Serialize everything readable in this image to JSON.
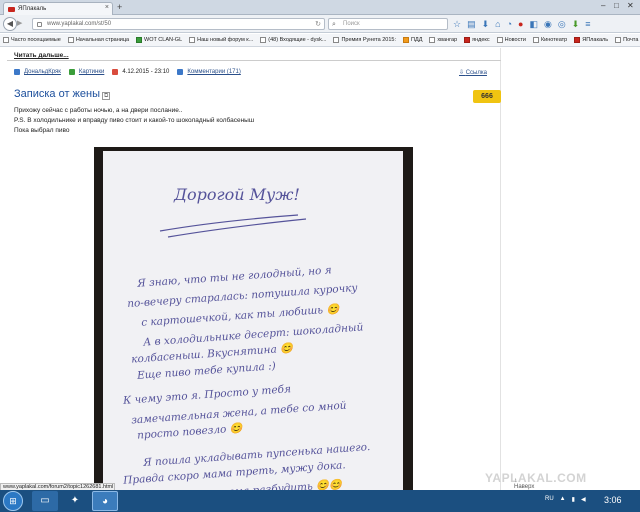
{
  "browser": {
    "tab_title": "ЯПлакаль",
    "new_tab": "+",
    "url": "www.yaplakal.com/st/50",
    "search_placeholder": "Поиск"
  },
  "bookmarks": [
    "Часто посещаемые",
    "Начальная страница",
    "WOT CLAN-GL",
    "Наш новый форум к...",
    "(48) Входящие - dysk...",
    "Премия Рунета 2015:",
    "ПДД",
    "хвангар",
    "яндекс",
    "Новости",
    "Кинотеатр",
    "ЯПлакаль",
    "Почта"
  ],
  "post": {
    "read_more": "Читать дальше...",
    "author": "ДональдКряк",
    "category": "Картинки",
    "date": "4.12.2015 - 23:10",
    "comments": "Комментарии (171)",
    "link_label": "Ссылка",
    "title": "Записка от жены",
    "rating": "666",
    "lines": [
      "Прихожу сейчас с работы ночью, а на двери послание..",
      "P.S. В холодильнике и вправду пиво стоит и какой-то шоколадный колбасеныш",
      "Пока выбрал пиво"
    ]
  },
  "note": {
    "heading": "Дорогой Муж!",
    "lines": [
      "Я знаю, что ты не голодный, но я",
      "по-вечеру старалась: потушила курочку",
      "с картошечкой, как ты любишь 😊",
      "А в холодильнике десерт: шоколадный",
      "колбасеныш. Вкуснятина 😊",
      "Еще пиво тебе купила :)",
      "К чему это я. Просто у тебя",
      "замечательная жена, а тебе со мной",
      "просто повезло 😊",
      "Я пошла укладывать пупсенька нашего.",
      "Правда скоро мама треть, мужу дока.",
      "Мамочка занял мама разбудить 😊😊"
    ]
  },
  "watermark": "YAPLAKAL.COM",
  "up_link": "Наверх",
  "status_url": "www.yaplakal.com/forum2/topic1262681.html",
  "taskbar": {
    "lang": "RU",
    "time": "3:06"
  }
}
